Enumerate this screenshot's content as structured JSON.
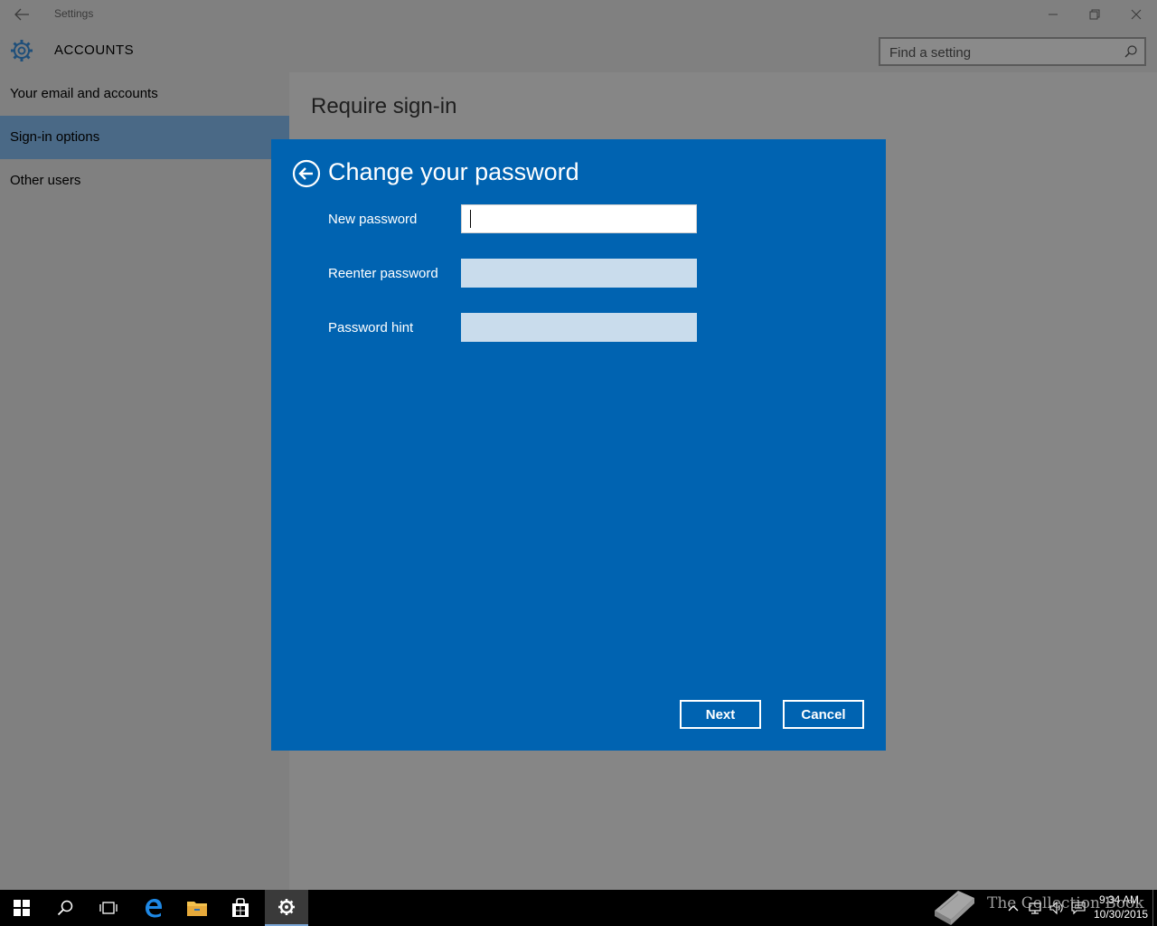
{
  "window": {
    "app_title": "Settings",
    "section_title": "ACCOUNTS",
    "search_placeholder": "Find a setting"
  },
  "nav": {
    "items": [
      {
        "label": "Your email and accounts",
        "selected": false
      },
      {
        "label": "Sign-in options",
        "selected": true
      },
      {
        "label": "Other users",
        "selected": false
      }
    ]
  },
  "content": {
    "heading": "Require sign-in"
  },
  "dialog": {
    "title": "Change your password",
    "fields": [
      {
        "label": "New password",
        "value": "",
        "state": "focused"
      },
      {
        "label": "Reenter password",
        "value": "",
        "state": "inactive"
      },
      {
        "label": "Password hint",
        "value": "",
        "state": "inactive"
      }
    ],
    "next_label": "Next",
    "cancel_label": "Cancel",
    "accent_color": "#0063b1"
  },
  "taskbar": {
    "apps": [
      {
        "icon": "windows-start-icon"
      },
      {
        "icon": "search-icon"
      },
      {
        "icon": "task-view-icon"
      },
      {
        "icon": "edge-icon"
      },
      {
        "icon": "file-explorer-icon"
      },
      {
        "icon": "store-icon"
      },
      {
        "icon": "settings-gear-icon",
        "active": true
      }
    ],
    "tray_icons": [
      "show-hidden-icons-chevron",
      "network-icon",
      "volume-icon",
      "action-center-icon"
    ],
    "time": "9:34 AM",
    "date": "10/30/2015"
  },
  "watermark": {
    "text": "The Collection Book"
  }
}
